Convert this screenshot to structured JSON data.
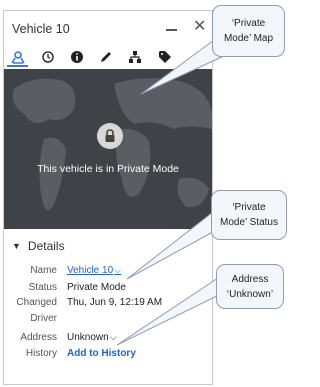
{
  "window": {
    "title": "Vehicle 10"
  },
  "toolbar": {
    "icons": [
      "location-pin-icon",
      "history-icon",
      "info-icon",
      "pencil-icon",
      "hierarchy-icon",
      "tag-icon"
    ],
    "active_color": "#3a78d8"
  },
  "map": {
    "message": "This vehicle is in Private Mode"
  },
  "details": {
    "header": "Details",
    "rows": [
      {
        "label": "Name",
        "value": "Vehicle 10"
      },
      {
        "label": "Status",
        "value": "Private Mode"
      },
      {
        "label": "Changed",
        "value": "Thu, Jun 9, 12:19 AM"
      },
      {
        "label": "Driver",
        "value": ""
      },
      {
        "label": "Address",
        "value": "Unknown"
      },
      {
        "label": "History",
        "value": "Add to History"
      }
    ]
  },
  "callouts": {
    "map_line1": "‘Private",
    "map_line2": "Mode’ Map",
    "status_line1": "‘Private",
    "status_line2": "Mode’ Status",
    "address_line1": "Address",
    "address_line2": "‘Unknown’"
  },
  "colors": {
    "link": "#2563c9",
    "map_bg": "#3f4246",
    "callout_bg": "#f3f6fb"
  }
}
